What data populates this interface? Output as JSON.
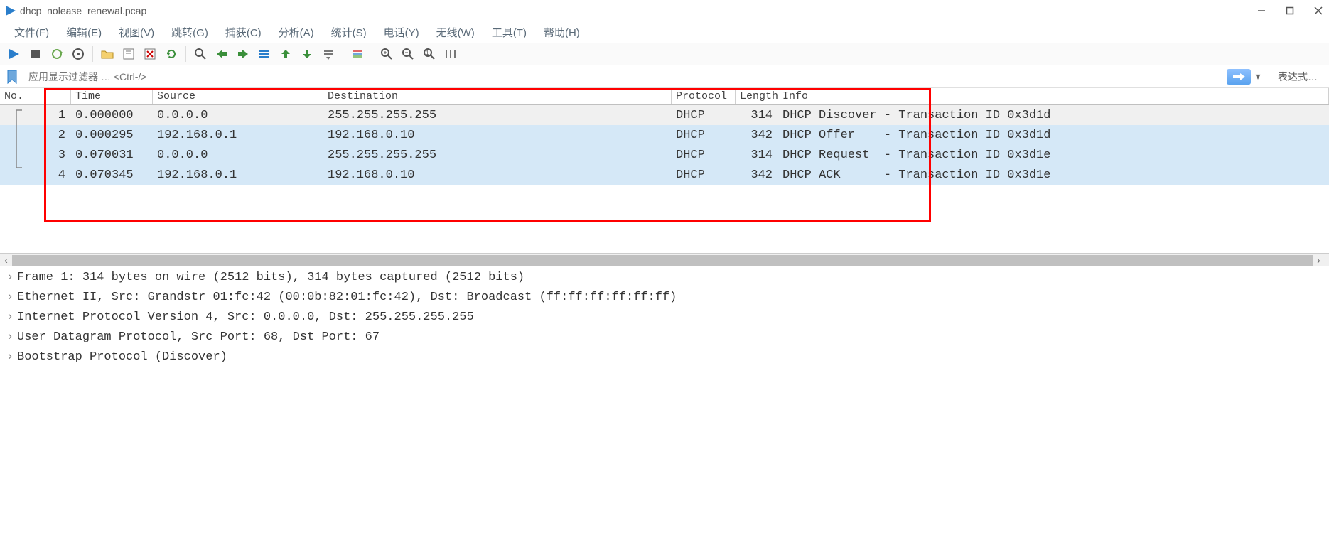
{
  "window": {
    "title": "dhcp_nolease_renewal.pcap"
  },
  "menu": {
    "file": "文件(F)",
    "edit": "编辑(E)",
    "view": "视图(V)",
    "go": "跳转(G)",
    "capture": "捕获(C)",
    "analyze": "分析(A)",
    "stats": "统计(S)",
    "telephony": "电话(Y)",
    "wireless": "无线(W)",
    "tools": "工具(T)",
    "help": "帮助(H)"
  },
  "filter": {
    "placeholder": "应用显示过滤器 … <Ctrl-/>",
    "expression": "表达式…"
  },
  "columns": {
    "no": "No.",
    "time": "Time",
    "source": "Source",
    "dest": "Destination",
    "proto": "Protocol",
    "len": "Length",
    "info": "Info"
  },
  "rows": [
    {
      "no": "1",
      "time": "0.000000",
      "src": "0.0.0.0",
      "dst": "255.255.255.255",
      "proto": "DHCP",
      "len": "314",
      "info": "DHCP Discover - Transaction ID 0x3d1d",
      "sel": true,
      "hl": false
    },
    {
      "no": "2",
      "time": "0.000295",
      "src": "192.168.0.1",
      "dst": "192.168.0.10",
      "proto": "DHCP",
      "len": "342",
      "info": "DHCP Offer    - Transaction ID 0x3d1d",
      "sel": false,
      "hl": true
    },
    {
      "no": "3",
      "time": "0.070031",
      "src": "0.0.0.0",
      "dst": "255.255.255.255",
      "proto": "DHCP",
      "len": "314",
      "info": "DHCP Request  - Transaction ID 0x3d1e",
      "sel": false,
      "hl": true
    },
    {
      "no": "4",
      "time": "0.070345",
      "src": "192.168.0.1",
      "dst": "192.168.0.10",
      "proto": "DHCP",
      "len": "342",
      "info": "DHCP ACK      - Transaction ID 0x3d1e",
      "sel": false,
      "hl": true
    }
  ],
  "details": [
    "Frame 1: 314 bytes on wire (2512 bits), 314 bytes captured (2512 bits)",
    "Ethernet II, Src: Grandstr_01:fc:42 (00:0b:82:01:fc:42), Dst: Broadcast (ff:ff:ff:ff:ff:ff)",
    "Internet Protocol Version 4, Src: 0.0.0.0, Dst: 255.255.255.255",
    "User Datagram Protocol, Src Port: 68, Dst Port: 67",
    "Bootstrap Protocol (Discover)"
  ]
}
